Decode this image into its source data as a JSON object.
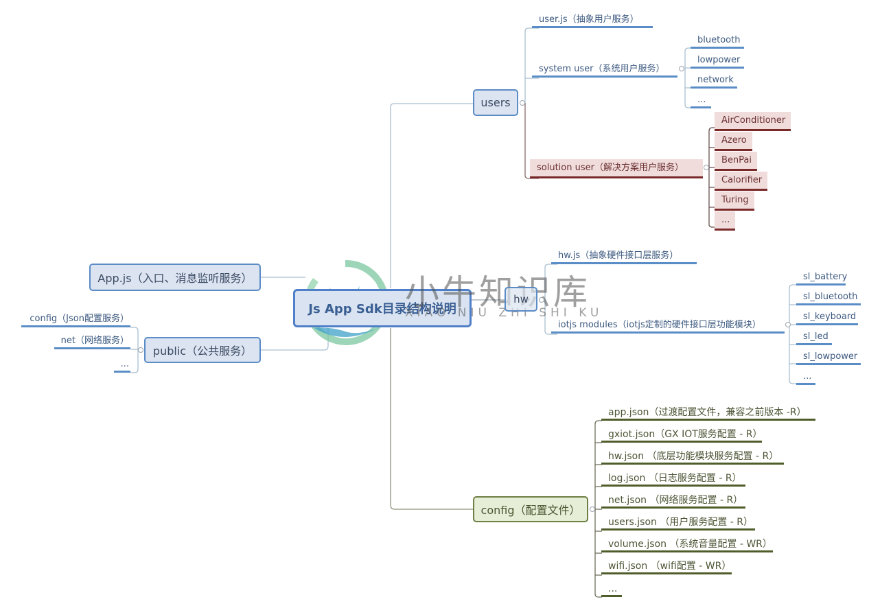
{
  "root": {
    "label": "Js App Sdk目录结构说明"
  },
  "left": {
    "appjs": {
      "label": "App.js（入口、消息监听服务）"
    },
    "public": {
      "label": "public（公共服务）",
      "children": [
        "config（Json配置服务）",
        "net（网络服务）",
        "..."
      ]
    }
  },
  "users": {
    "label": "users",
    "userjs": "user.js（抽象用户服务）",
    "system": {
      "label": "system user（系统用户服务）",
      "children": [
        "bluetooth",
        "lowpower",
        "network",
        "..."
      ]
    },
    "solution": {
      "label": "solution user（解决方案用户服务）",
      "children": [
        "AirConditioner",
        "Azero",
        "BenPai",
        "Calorifier",
        "Turing",
        "..."
      ]
    }
  },
  "hw": {
    "label": "hw",
    "hwjs": "hw.js（抽象硬件接口层服务）",
    "iotjs": {
      "label": "iotjs modules（iotjs定制的硬件接口层功能模块）",
      "children": [
        "sl_battery",
        "sl_bluetooth",
        "sl_keyboard",
        "sl_led",
        "sl_lowpower",
        "..."
      ]
    }
  },
  "config": {
    "label": "config（配置文件）",
    "children": [
      "app.json（过渡配置文件，兼容之前版本 -R）",
      "gxiot.json（GX IOT服务配置 - R）",
      "hw.json （底层功能模块服务配置 - R）",
      "log.json （日志服务配置 - R）",
      "net.json （网络服务配置 - R）",
      "users.json （用户服务配置 - R）",
      "volume.json （系统音量配置 - WR）",
      "wifi.json （wifi配置 - WR）",
      "..."
    ]
  },
  "watermark": {
    "title": "小牛知识库",
    "subtitle": "XIAO NIU ZHI SHI KU"
  },
  "colors": {
    "blue": "#5b8cc6",
    "green": "#4f5d2a",
    "red": "#7a2929",
    "root": "#4e7fc8"
  }
}
